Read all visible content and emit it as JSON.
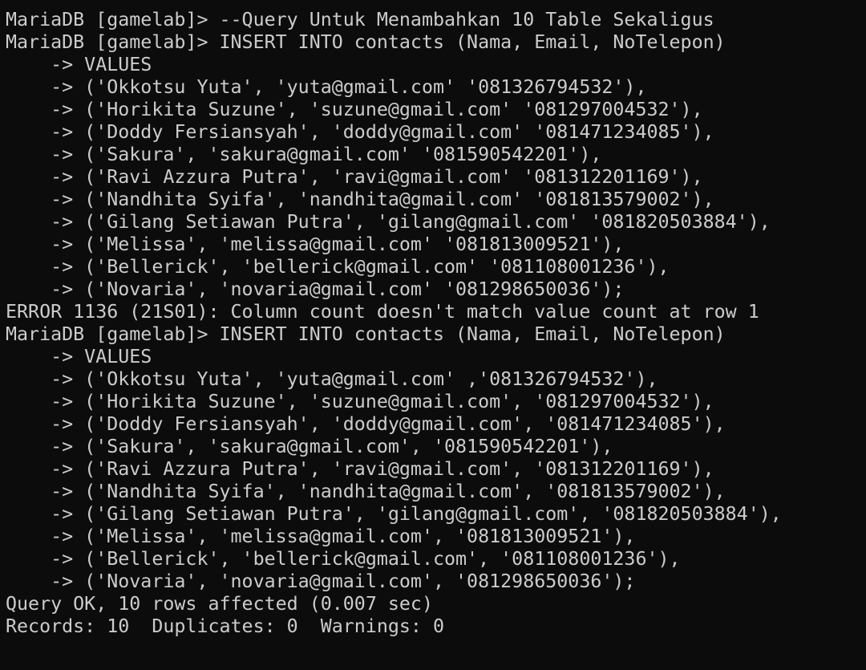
{
  "colors": {
    "background": "#0c0c0c",
    "text": "#cccccc"
  },
  "terminal": {
    "lines": [
      "MariaDB [gamelab]> --Query Untuk Menambahkan 10 Table Sekaligus",
      "MariaDB [gamelab]> INSERT INTO contacts (Nama, Email, NoTelepon)",
      "    -> VALUES",
      "    -> ('Okkotsu Yuta', 'yuta@gmail.com' '081326794532'),",
      "    -> ('Horikita Suzune', 'suzune@gmail.com' '081297004532'),",
      "    -> ('Doddy Fersiansyah', 'doddy@gmail.com' '081471234085'),",
      "    -> ('Sakura', 'sakura@gmail.com' '081590542201'),",
      "    -> ('Ravi Azzura Putra', 'ravi@gmail.com' '081312201169'),",
      "    -> ('Nandhita Syifa', 'nandhita@gmail.com' '081813579002'),",
      "    -> ('Gilang Setiawan Putra', 'gilang@gmail.com' '081820503884'),",
      "    -> ('Melissa', 'melissa@gmail.com' '081813009521'),",
      "    -> ('Bellerick', 'bellerick@gmail.com' '081108001236'),",
      "    -> ('Novaria', 'novaria@gmail.com' '081298650036');",
      "ERROR 1136 (21S01): Column count doesn't match value count at row 1",
      "MariaDB [gamelab]> INSERT INTO contacts (Nama, Email, NoTelepon)",
      "    -> VALUES",
      "    -> ('Okkotsu Yuta', 'yuta@gmail.com' ,'081326794532'),",
      "    -> ('Horikita Suzune', 'suzune@gmail.com', '081297004532'),",
      "    -> ('Doddy Fersiansyah', 'doddy@gmail.com', '081471234085'),",
      "    -> ('Sakura', 'sakura@gmail.com', '081590542201'),",
      "    -> ('Ravi Azzura Putra', 'ravi@gmail.com', '081312201169'),",
      "    -> ('Nandhita Syifa', 'nandhita@gmail.com', '081813579002'),",
      "    -> ('Gilang Setiawan Putra', 'gilang@gmail.com', '081820503884'),",
      "    -> ('Melissa', 'melissa@gmail.com', '081813009521'),",
      "    -> ('Bellerick', 'bellerick@gmail.com', '081108001236'),",
      "    -> ('Novaria', 'novaria@gmail.com', '081298650036');",
      "Query OK, 10 rows affected (0.007 sec)",
      "Records: 10  Duplicates: 0  Warnings: 0"
    ]
  }
}
